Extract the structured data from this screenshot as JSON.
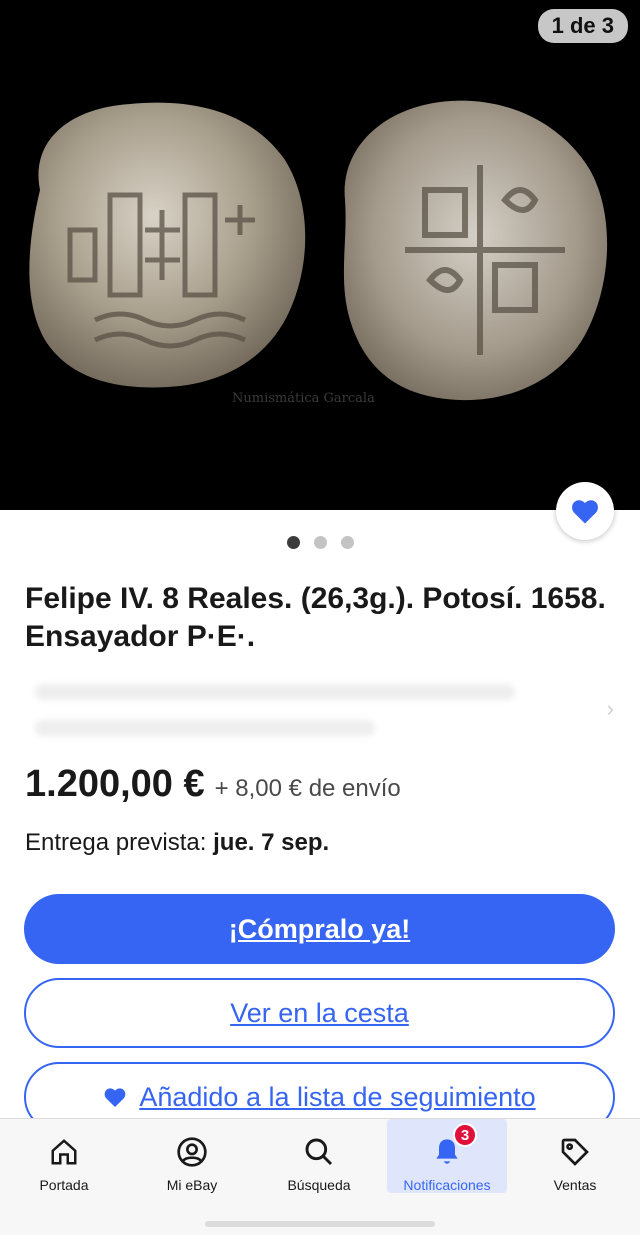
{
  "gallery": {
    "counter": "1 de 3",
    "watermark": "Numismática Garcala",
    "total_dots": 3,
    "active_dot": 0
  },
  "listing": {
    "title": "Felipe IV. 8 Reales. (26,3g.). Potosí. 1658. Ensayador P·E·.",
    "price": "1.200,00 €",
    "shipping": "+ 8,00 € de envío",
    "delivery_label": "Entrega prevista:",
    "delivery_date": "jue. 7 sep."
  },
  "actions": {
    "buy_now": "¡Cómpralo ya!",
    "view_cart": "Ver en la cesta",
    "watchlist": "Añadido a la lista de seguimiento"
  },
  "tabbar": {
    "tabs": [
      {
        "label": "Portada",
        "icon": "home-icon"
      },
      {
        "label": "Mi eBay",
        "icon": "user-icon"
      },
      {
        "label": "Búsqueda",
        "icon": "search-icon"
      },
      {
        "label": "Notificaciones",
        "icon": "bell-icon",
        "badge": "3",
        "active": true
      },
      {
        "label": "Ventas",
        "icon": "tag-icon"
      }
    ]
  },
  "colors": {
    "accent": "#3665f3",
    "badge": "#e0103a",
    "gallery_bg": "#000000"
  }
}
